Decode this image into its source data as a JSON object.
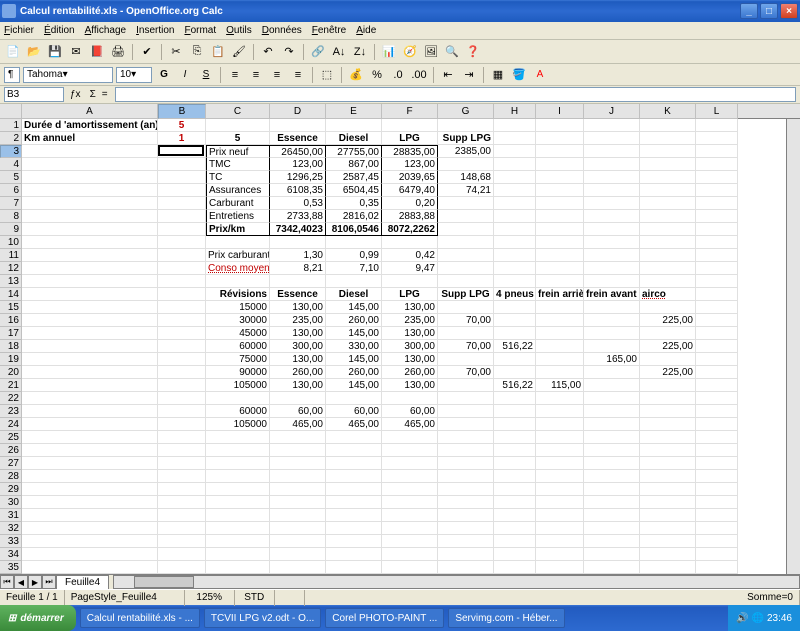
{
  "title": "Calcul rentabilité.xls - OpenOffice.org Calc",
  "menus": [
    "Fichier",
    "Édition",
    "Affichage",
    "Insertion",
    "Format",
    "Outils",
    "Données",
    "Fenêtre",
    "Aide"
  ],
  "font": "Tahoma",
  "fontsize": "10",
  "cellref": "B3",
  "formula": "",
  "cols": [
    "A",
    "B",
    "C",
    "D",
    "E",
    "F",
    "G",
    "H",
    "I",
    "J",
    "K",
    "L"
  ],
  "cw": [
    136,
    48,
    64,
    56,
    56,
    56,
    56,
    42,
    48,
    56,
    56,
    42
  ],
  "r1": {
    "a": "Durée d 'amortissement (an)",
    "b": "5"
  },
  "r2": {
    "a": "Km annuel",
    "b": "1",
    "c": "5",
    "d": "Essence",
    "e": "Diesel",
    "f": "LPG",
    "g": "Supp LPG"
  },
  "r3": {
    "c": "Prix neuf",
    "d": "26450,00",
    "e": "27755,00",
    "f": "28835,00",
    "g": "2385,00"
  },
  "r4": {
    "c": "TMC",
    "d": "123,00",
    "e": "867,00",
    "f": "123,00"
  },
  "r5": {
    "c": "TC",
    "d": "1296,25",
    "e": "2587,45",
    "f": "2039,65",
    "g": "148,68"
  },
  "r6": {
    "c": "Assurances",
    "d": "6108,35",
    "e": "6504,45",
    "f": "6479,40",
    "g": "74,21"
  },
  "r7": {
    "c": "Carburant",
    "d": "0,53",
    "e": "0,35",
    "f": "0,20"
  },
  "r8": {
    "c": "Entretiens",
    "d": "2733,88",
    "e": "2816,02",
    "f": "2883,88"
  },
  "r9": {
    "c": "Prix/km",
    "d": "7342,4023",
    "e": "8106,0546",
    "f": "8072,2262"
  },
  "r11": {
    "c": "Prix carburant",
    "d": "1,30",
    "e": "0,99",
    "f": "0,42"
  },
  "r12": {
    "c": "Conso moyenne",
    "d": "8,21",
    "e": "7,10",
    "f": "9,47"
  },
  "r14": {
    "c": "Révisions",
    "d": "Essence",
    "e": "Diesel",
    "f": "LPG",
    "g": "Supp LPG",
    "h": "4 pneus",
    "i": "frein arrière",
    "j": "frein avant",
    "k": "airco"
  },
  "r15": {
    "c": "15000",
    "d": "130,00",
    "e": "145,00",
    "f": "130,00"
  },
  "r16": {
    "c": "30000",
    "d": "235,00",
    "e": "260,00",
    "f": "235,00",
    "g": "70,00",
    "k": "225,00"
  },
  "r17": {
    "c": "45000",
    "d": "130,00",
    "e": "145,00",
    "f": "130,00"
  },
  "r18": {
    "c": "60000",
    "d": "300,00",
    "e": "330,00",
    "f": "300,00",
    "g": "70,00",
    "h": "516,22",
    "k": "225,00"
  },
  "r19": {
    "c": "75000",
    "d": "130,00",
    "e": "145,00",
    "f": "130,00",
    "j": "165,00"
  },
  "r20": {
    "c": "90000",
    "d": "260,00",
    "e": "260,00",
    "f": "260,00",
    "g": "70,00",
    "k": "225,00"
  },
  "r21": {
    "c": "105000",
    "d": "130,00",
    "e": "145,00",
    "f": "130,00",
    "h": "516,22",
    "i": "115,00"
  },
  "r23": {
    "c": "60000",
    "d": "60,00",
    "e": "60,00",
    "f": "60,00"
  },
  "r24": {
    "c": "105000",
    "d": "465,00",
    "e": "465,00",
    "f": "465,00"
  },
  "tab": "Feuille4",
  "status": {
    "sheet": "Feuille 1 / 1",
    "style": "PageStyle_Feuille4",
    "zoom": "125%",
    "std": "STD",
    "sum": "Somme=0"
  },
  "taskbar": {
    "start": "démarrer",
    "tasks": [
      "Calcul rentabilité.xls - ...",
      "TCVII LPG v2.odt - O...",
      "Corel PHOTO-PAINT ...",
      "Servimg.com - Héber..."
    ],
    "time": "23:46"
  },
  "chart_data": {
    "type": "table",
    "title": "Calcul rentabilité",
    "params": {
      "Durée d'amortissement (an)": 5,
      "Km annuel": 1
    },
    "cost_table": {
      "columns": [
        "Essence",
        "Diesel",
        "LPG",
        "Supp LPG"
      ],
      "rows": [
        {
          "label": "Prix neuf",
          "values": [
            26450.0,
            27755.0,
            28835.0,
            2385.0
          ]
        },
        {
          "label": "TMC",
          "values": [
            123.0,
            867.0,
            123.0,
            null
          ]
        },
        {
          "label": "TC",
          "values": [
            1296.25,
            2587.45,
            2039.65,
            148.68
          ]
        },
        {
          "label": "Assurances",
          "values": [
            6108.35,
            6504.45,
            6479.4,
            74.21
          ]
        },
        {
          "label": "Carburant",
          "values": [
            0.53,
            0.35,
            0.2,
            null
          ]
        },
        {
          "label": "Entretiens",
          "values": [
            2733.88,
            2816.02,
            2883.88,
            null
          ]
        },
        {
          "label": "Prix/km",
          "values": [
            7342.4023,
            8106.0546,
            8072.2262,
            null
          ]
        }
      ]
    },
    "fuel": {
      "Prix carburant": [
        1.3,
        0.99,
        0.42
      ],
      "Conso moyenne": [
        8.21,
        7.1,
        9.47
      ]
    },
    "revisions": {
      "columns": [
        "Révisions",
        "Essence",
        "Diesel",
        "LPG",
        "Supp LPG",
        "4 pneus",
        "frein arrière",
        "frein avant",
        "airco"
      ],
      "rows": [
        [
          15000,
          130.0,
          145.0,
          130.0,
          null,
          null,
          null,
          null,
          null
        ],
        [
          30000,
          235.0,
          260.0,
          235.0,
          70.0,
          null,
          null,
          null,
          225.0
        ],
        [
          45000,
          130.0,
          145.0,
          130.0,
          null,
          null,
          null,
          null,
          null
        ],
        [
          60000,
          300.0,
          330.0,
          300.0,
          70.0,
          516.22,
          null,
          null,
          225.0
        ],
        [
          75000,
          130.0,
          145.0,
          130.0,
          null,
          null,
          null,
          165.0,
          null
        ],
        [
          90000,
          260.0,
          260.0,
          260.0,
          70.0,
          null,
          null,
          null,
          225.0
        ],
        [
          105000,
          130.0,
          145.0,
          130.0,
          null,
          516.22,
          115.0,
          null,
          null
        ]
      ],
      "extra": [
        [
          60000,
          60.0,
          60.0,
          60.0
        ],
        [
          105000,
          465.0,
          465.0,
          465.0
        ]
      ]
    }
  }
}
